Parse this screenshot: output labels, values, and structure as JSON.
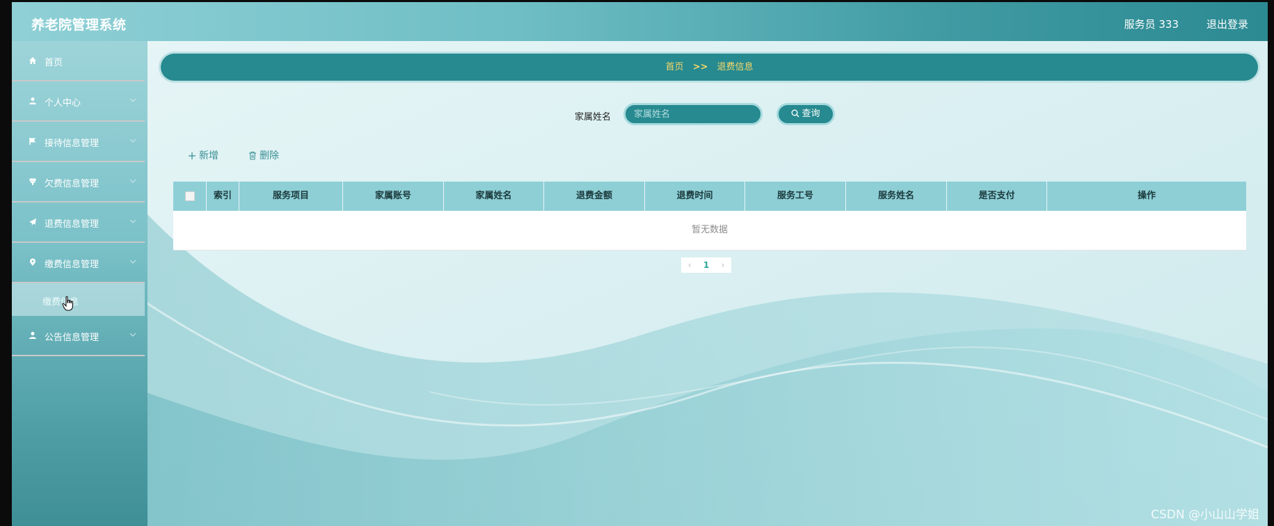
{
  "header": {
    "app_title": "养老院管理系统",
    "user_label": "服务员 333",
    "logout_label": "退出登录"
  },
  "sidebar": {
    "items": [
      {
        "label": "首页",
        "icon": "home-icon"
      },
      {
        "label": "个人中心",
        "icon": "user-icon"
      },
      {
        "label": "接待信息管理",
        "icon": "flag-icon"
      },
      {
        "label": "欠费信息管理",
        "icon": "cup-icon"
      },
      {
        "label": "退费信息管理",
        "icon": "send-icon"
      },
      {
        "label": "缴费信息管理",
        "icon": "location-icon"
      },
      {
        "label": "公告信息管理",
        "icon": "user-icon"
      }
    ],
    "submenu_label": "缴费信息"
  },
  "breadcrumb": {
    "home": "首页",
    "separator": ">>",
    "current": "退费信息"
  },
  "search": {
    "label": "家属姓名",
    "placeholder": "家属姓名",
    "button_label": "查询"
  },
  "actions": {
    "add_label": "新增",
    "delete_label": "删除"
  },
  "table": {
    "columns": [
      "索引",
      "服务项目",
      "家属账号",
      "家属姓名",
      "退费金额",
      "退费时间",
      "服务工号",
      "服务姓名",
      "是否支付",
      "操作"
    ],
    "empty_text": "暂无数据"
  },
  "pagination": {
    "prev": "‹",
    "current_page": "1",
    "next": "›"
  },
  "watermark": "CSDN @小山山学姐",
  "colors": {
    "accent": "#268a90",
    "breadcrumb_text": "#f7d66a",
    "table_header": "#8ecfd6"
  }
}
